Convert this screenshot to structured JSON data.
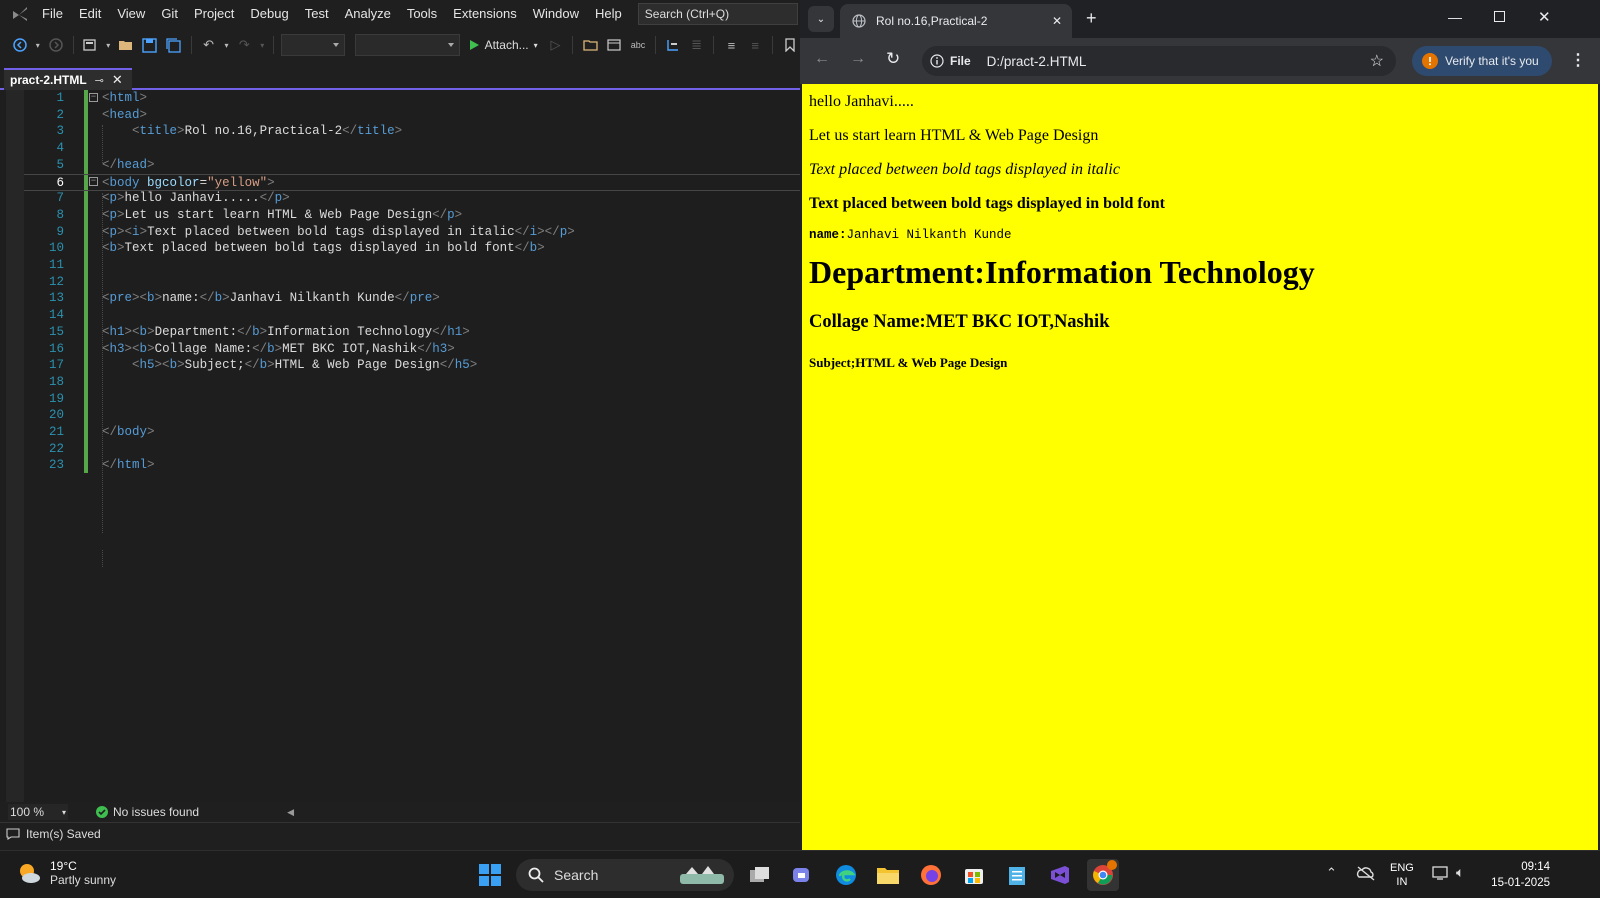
{
  "vs": {
    "menu": [
      "File",
      "Edit",
      "View",
      "Git",
      "Project",
      "Debug",
      "Test",
      "Analyze",
      "Tools",
      "Extensions",
      "Window",
      "Help"
    ],
    "search_placeholder": "Search (Ctrl+Q)",
    "attach_label": "Attach...",
    "tab_title": "pract-2.HTML",
    "zoom": "100 %",
    "issues": "No issues found",
    "status": "Item(s) Saved",
    "lines": [
      {
        "n": "1",
        "html": "<span class=\"br\">&lt;</span><span class=\"tg\">html</span><span class=\"br\">&gt;</span>"
      },
      {
        "n": "2",
        "html": "<span class=\"br\">&lt;</span><span class=\"tg\">head</span><span class=\"br\">&gt;</span>"
      },
      {
        "n": "3",
        "html": "    <span class=\"br\">&lt;</span><span class=\"tg\">title</span><span class=\"br\">&gt;</span><span class=\"tx\">Rol no.16,Practical-2</span><span class=\"br\">&lt;/</span><span class=\"tg\">title</span><span class=\"br\">&gt;</span>"
      },
      {
        "n": "4",
        "html": ""
      },
      {
        "n": "5",
        "html": "<span class=\"br\">&lt;/</span><span class=\"tg\">head</span><span class=\"br\">&gt;</span>"
      },
      {
        "n": "6",
        "html": "<span class=\"br\">&lt;</span><span class=\"tg\">body</span> <span class=\"at\">bgcolor</span><span class=\"tx\">=</span><span class=\"av\">\"yellow\"</span><span class=\"br\">&gt;</span>"
      },
      {
        "n": "7",
        "html": "<span class=\"br\">&lt;</span><span class=\"tg\">p</span><span class=\"br\">&gt;</span><span class=\"tx\">hello Janhavi.....</span><span class=\"br\">&lt;/</span><span class=\"tg\">p</span><span class=\"br\">&gt;</span>"
      },
      {
        "n": "8",
        "html": "<span class=\"br\">&lt;</span><span class=\"tg\">p</span><span class=\"br\">&gt;</span><span class=\"tx\">Let us start learn HTML &amp; Web Page Design</span><span class=\"br\">&lt;/</span><span class=\"tg\">p</span><span class=\"br\">&gt;</span>"
      },
      {
        "n": "9",
        "html": "<span class=\"br\">&lt;</span><span class=\"tg\">p</span><span class=\"br\">&gt;&lt;</span><span class=\"tg\">i</span><span class=\"br\">&gt;</span><span class=\"tx\">Text placed between bold tags displayed in italic</span><span class=\"br\">&lt;/</span><span class=\"tg\">i</span><span class=\"br\">&gt;&lt;/</span><span class=\"tg\">p</span><span class=\"br\">&gt;</span>"
      },
      {
        "n": "10",
        "html": "<span class=\"br\">&lt;</span><span class=\"tg\">b</span><span class=\"br\">&gt;</span><span class=\"tx\">Text placed between bold tags displayed in bold font</span><span class=\"br\">&lt;/</span><span class=\"tg\">b</span><span class=\"br\">&gt;</span>"
      },
      {
        "n": "11",
        "html": ""
      },
      {
        "n": "12",
        "html": ""
      },
      {
        "n": "13",
        "html": "<span class=\"br\">&lt;</span><span class=\"tg\">pre</span><span class=\"br\">&gt;&lt;</span><span class=\"tg\">b</span><span class=\"br\">&gt;</span><span class=\"tx\">name:</span><span class=\"br\">&lt;/</span><span class=\"tg\">b</span><span class=\"br\">&gt;</span><span class=\"tx\">Janhavi Nilkanth Kunde</span><span class=\"br\">&lt;/</span><span class=\"tg\">pre</span><span class=\"br\">&gt;</span>"
      },
      {
        "n": "14",
        "html": ""
      },
      {
        "n": "15",
        "html": "<span class=\"br\">&lt;</span><span class=\"tg\">h1</span><span class=\"br\">&gt;&lt;</span><span class=\"tg\">b</span><span class=\"br\">&gt;</span><span class=\"tx\">Department:</span><span class=\"br\">&lt;/</span><span class=\"tg\">b</span><span class=\"br\">&gt;</span><span class=\"tx\">Information Technology</span><span class=\"br\">&lt;/</span><span class=\"tg\">h1</span><span class=\"br\">&gt;</span>"
      },
      {
        "n": "16",
        "html": "<span class=\"br\">&lt;</span><span class=\"tg\">h3</span><span class=\"br\">&gt;&lt;</span><span class=\"tg\">b</span><span class=\"br\">&gt;</span><span class=\"tx\">Collage Name:</span><span class=\"br\">&lt;/</span><span class=\"tg\">b</span><span class=\"br\">&gt;</span><span class=\"tx\">MET BKC IOT,Nashik</span><span class=\"br\">&lt;/</span><span class=\"tg\">h3</span><span class=\"br\">&gt;</span>"
      },
      {
        "n": "17",
        "html": "    <span class=\"br\">&lt;</span><span class=\"tg\">h5</span><span class=\"br\">&gt;&lt;</span><span class=\"tg\">b</span><span class=\"br\">&gt;</span><span class=\"tx\">Subject;</span><span class=\"br\">&lt;/</span><span class=\"tg\">b</span><span class=\"br\">&gt;</span><span class=\"tx\">HTML &amp; Web Page Design</span><span class=\"br\">&lt;/</span><span class=\"tg\">h5</span><span class=\"br\">&gt;</span>"
      },
      {
        "n": "18",
        "html": ""
      },
      {
        "n": "19",
        "html": ""
      },
      {
        "n": "20",
        "html": ""
      },
      {
        "n": "21",
        "html": "<span class=\"br\">&lt;/</span><span class=\"tg\">body</span><span class=\"br\">&gt;</span>"
      },
      {
        "n": "22",
        "html": ""
      },
      {
        "n": "23",
        "html": "<span class=\"br\">&lt;/</span><span class=\"tg\">html</span><span class=\"br\">&gt;</span>"
      }
    ]
  },
  "chrome": {
    "tab_title": "Rol no.16,Practical-2",
    "file_chip": "File",
    "url": "D:/pract-2.HTML",
    "verify_label": "Verify that it's you",
    "page": {
      "p1": "hello Janhavi.....",
      "p2": "Let us start learn HTML & Web Page Design",
      "p3": "Text placed between bold tags displayed in italic",
      "b1": "Text placed between bold tags displayed in bold font",
      "pre_label": "name:",
      "pre_value": "Janhavi Nilkanth Kunde",
      "h1_label": "Department:",
      "h1_value": "Information Technology",
      "h3_label": "Collage Name:",
      "h3_value": "MET BKC IOT,Nashik",
      "h5_label": "Subject;",
      "h5_value": "HTML & Web Page Design"
    }
  },
  "taskbar": {
    "weather_temp": "19°C",
    "weather_desc": "Partly sunny",
    "search_label": "Search",
    "lang": "ENG",
    "region": "IN",
    "time": "09:14",
    "date": "15-01-2025"
  },
  "colors": {
    "page_bg": "#ffff00",
    "vs_accent": "#7160e8"
  }
}
